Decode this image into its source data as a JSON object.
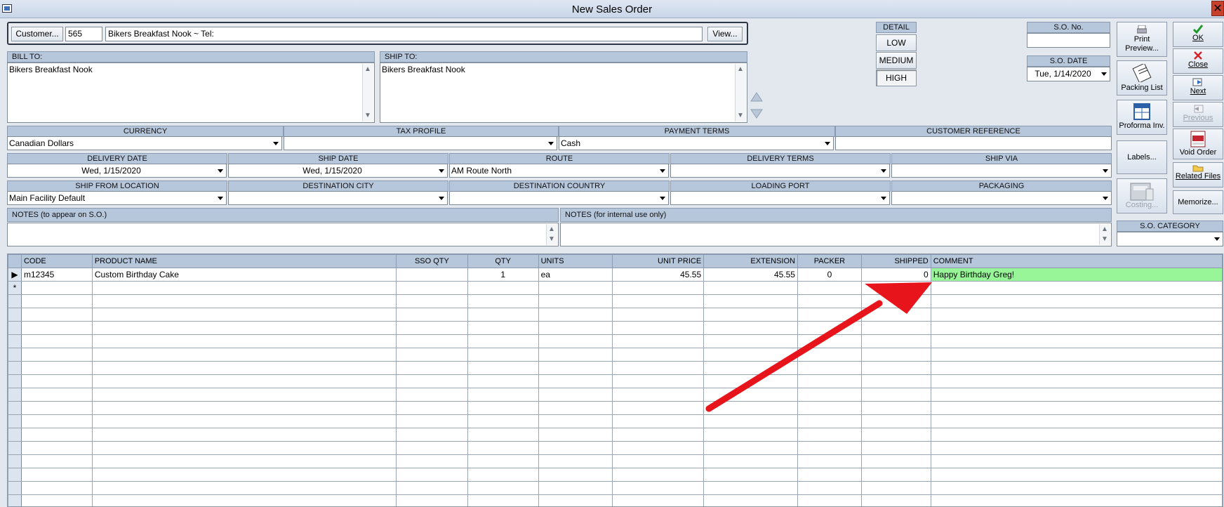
{
  "window": {
    "title": "New Sales Order",
    "close": "✕"
  },
  "customer": {
    "button": "Customer...",
    "id": "565",
    "name": "Bikers Breakfast Nook  ~  Tel:",
    "view_button": "View..."
  },
  "bill_to": {
    "label": "BILL TO:",
    "value": "Bikers Breakfast Nook"
  },
  "ship_to": {
    "label": "SHIP TO:",
    "value": "Bikers Breakfast Nook"
  },
  "detail": {
    "label": "DETAIL",
    "options": [
      "LOW",
      "MEDIUM",
      "HIGH"
    ],
    "selected": "HIGH"
  },
  "so": {
    "no_label": "S.O. No.",
    "no_value": "",
    "date_label": "S.O. DATE",
    "date_value": "Tue, 1/14/2020",
    "category_label": "S.O. CATEGORY",
    "category_value": ""
  },
  "side_buttons": {
    "print_preview": "Print Preview...",
    "packing_list": "Packing List",
    "proforma": "Proforma Inv.",
    "labels": "Labels...",
    "costing": "Costing...",
    "ok": "OK",
    "close": "Close",
    "next": "Next",
    "previous": "Previous",
    "void_order": "Void Order",
    "related_files": "Related Files",
    "memorize": "Memorize..."
  },
  "row1": {
    "currency_label": "CURRENCY",
    "currency": "Canadian Dollars",
    "tax_label": "TAX PROFILE",
    "tax": "",
    "terms_label": "PAYMENT TERMS",
    "terms": "Cash",
    "ref_label": "CUSTOMER REFERENCE",
    "ref": ""
  },
  "row2": {
    "delivery_date_label": "DELIVERY DATE",
    "delivery_date": "Wed, 1/15/2020",
    "ship_date_label": "SHIP DATE",
    "ship_date": "Wed, 1/15/2020",
    "route_label": "ROUTE",
    "route": "AM Route North",
    "delivery_terms_label": "DELIVERY TERMS",
    "delivery_terms": "",
    "ship_via_label": "SHIP VIA",
    "ship_via": ""
  },
  "row3": {
    "ship_from_label": "SHIP FROM LOCATION",
    "ship_from": "Main Facility Default",
    "dest_city_label": "DESTINATION CITY",
    "dest_city": "",
    "dest_country_label": "DESTINATION COUNTRY",
    "dest_country": "",
    "loading_port_label": "LOADING PORT",
    "loading_port": "",
    "packaging_label": "PACKAGING",
    "packaging": ""
  },
  "notes": {
    "so_label": "NOTES (to appear on S.O.)",
    "so_value": "",
    "internal_label": "NOTES (for internal use only)",
    "internal_value": ""
  },
  "grid": {
    "columns": [
      "CODE",
      "PRODUCT NAME",
      "SSO QTY",
      "QTY",
      "UNITS",
      "UNIT PRICE",
      "EXTENSION",
      "PACKER",
      "SHIPPED",
      "COMMENT"
    ],
    "rows": [
      {
        "code": "m12345",
        "product": "Custom Birthday Cake",
        "sso_qty": "",
        "qty": "1",
        "units": "ea",
        "unit_price": "45.55",
        "extension": "45.55",
        "packer": "0",
        "shipped": "0",
        "comment": "Happy Birthday Greg!"
      }
    ],
    "new_row_marker": "*",
    "current_row_marker": "▶"
  },
  "colors": {
    "annotation_arrow": "#e8141b",
    "comment_highlight": "#98f598",
    "header_bg": "#b6c7dc"
  }
}
